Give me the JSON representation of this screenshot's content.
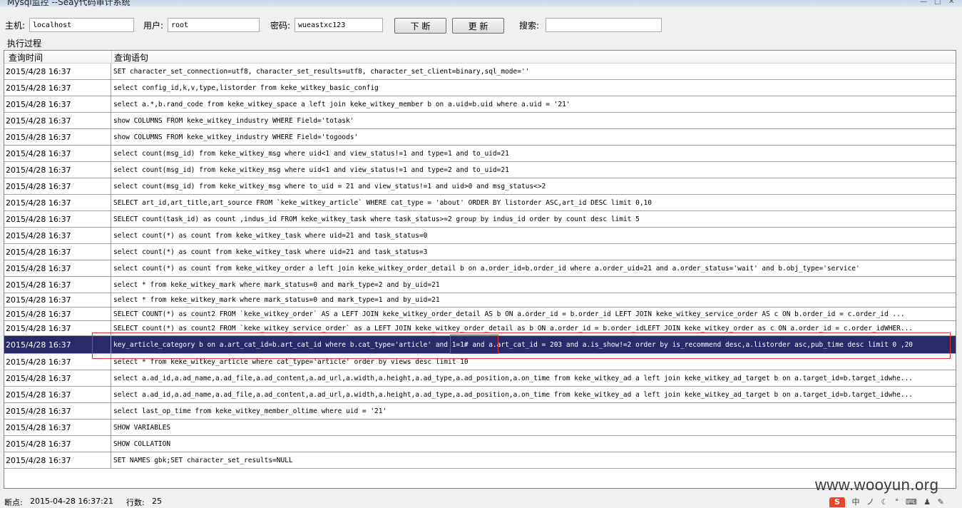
{
  "window": {
    "title": "Mysql监控 --Seay代码审计系统",
    "controls": [
      "—",
      "□",
      "✕"
    ]
  },
  "toolbar": {
    "host_label": "主机:",
    "host_value": "localhost",
    "user_label": "用户:",
    "user_value": "root",
    "password_label": "密码:",
    "password_value": "wueastxc123",
    "break_button": "下 断",
    "update_button": "更 新",
    "search_label": "搜索:",
    "search_value": ""
  },
  "section_label": "执行过程",
  "table": {
    "columns": [
      "查询时间",
      "查询语句"
    ],
    "rows": [
      {
        "time": "2015/4/28 16:37",
        "sql": "SET character_set_connection=utf8, character_set_results=utf8, character_set_client=binary,sql_mode=''"
      },
      {
        "time": "2015/4/28 16:37",
        "sql": "select config_id,k,v,type,listorder from keke_witkey_basic_config"
      },
      {
        "time": "2015/4/28 16:37",
        "sql": "select a.*,b.rand_code from keke_witkey_space a left join keke_witkey_member b on a.uid=b.uid where  a.uid = '21'"
      },
      {
        "time": "2015/4/28 16:37",
        "sql": "show COLUMNS FROM keke_witkey_industry WHERE Field='totask'"
      },
      {
        "time": "2015/4/28 16:37",
        "sql": "show COLUMNS FROM keke_witkey_industry WHERE Field='togoods'"
      },
      {
        "time": "2015/4/28 16:37",
        "sql": "select count(msg_id) from keke_witkey_msg where uid<1 and view_status!=1 and type=1 and  to_uid=21"
      },
      {
        "time": "2015/4/28 16:37",
        "sql": "select count(msg_id) from keke_witkey_msg where uid<1 and view_status!=1 and type=2 and  to_uid=21"
      },
      {
        "time": "2015/4/28 16:37",
        "sql": "select count(msg_id) from keke_witkey_msg where to_uid = 21 and view_status!=1 and uid>0 and msg_status<>2"
      },
      {
        "time": "2015/4/28 16:37",
        "sql": "SELECT art_id,art_title,art_source FROM `keke_witkey_article` WHERE cat_type = 'about' ORDER BY listorder ASC,art_id DESC limit 0,10"
      },
      {
        "time": "2015/4/28 16:37",
        "sql": "SELECT count(task_id) as count ,indus_id FROM  keke_witkey_task where task_status>=2 group by indus_id order by count desc limit 5"
      },
      {
        "time": "2015/4/28 16:37",
        "sql": "select count(*) as count from keke_witkey_task where uid=21 and task_status=0"
      },
      {
        "time": "2015/4/28 16:37",
        "sql": "select count(*) as count from keke_witkey_task where uid=21 and task_status=3"
      },
      {
        "time": "2015/4/28 16:37",
        "sql": "select count(*) as count from keke_witkey_order a left join keke_witkey_order_detail b on a.order_id=b.order_id where a.order_uid=21 and a.order_status='wait' and b.obj_type='service'"
      },
      {
        "time": "2015/4/28 16:37",
        "sql": "select * from keke_witkey_mark where mark_status=0 and mark_type=2 and by_uid=21"
      },
      {
        "time": "2015/4/28 16:37",
        "sql": "select * from keke_witkey_mark where mark_status=0 and mark_type=1 and by_uid=21"
      },
      {
        "time": "2015/4/28 16:37",
        "sql": "SELECT COUNT(*) as count2 FROM `keke_witkey_order` AS a  LEFT JOIN keke_witkey_order_detail AS b ON a.order_id = b.order_id  LEFT JOIN keke_witkey_service_order AS c ON b.order_id = c.order_id ..."
      },
      {
        "time": "2015/4/28 16:37",
        "sql": "SELECT count(*) as count2 FROM `keke_witkey_service_order` as a LEFT JOIN keke_witkey_order_detail as b ON a.order_id = b.order_idLEFT JOIN keke_witkey_order as c ON a.order_id = c.order_idWHER..."
      },
      {
        "time": "2015/4/28 16:37",
        "sql": "key_article_category b on a.art_cat_id=b.art_cat_id where b.cat_type='article'  and 1=1# and a.art_cat_id = 203 and a.is_show!=2 order by is_recommend desc,a.listorder asc,pub_time desc limit 0 ,20",
        "selected": true
      },
      {
        "time": "2015/4/28 16:37",
        "sql": "select * from keke_witkey_article where cat_type='article'  order by views desc limit 10"
      },
      {
        "time": "2015/4/28 16:37",
        "sql": "select a.ad_id,a.ad_name,a.ad_file,a.ad_content,a.ad_url,a.width,a.height,a.ad_type,a.ad_position,a.on_time from keke_witkey_ad a left join keke_witkey_ad_target b on a.target_id=b.target_idwhe..."
      },
      {
        "time": "2015/4/28 16:37",
        "sql": "select a.ad_id,a.ad_name,a.ad_file,a.ad_content,a.ad_url,a.width,a.height,a.ad_type,a.ad_position,a.on_time from keke_witkey_ad a left join keke_witkey_ad_target b on a.target_id=b.target_idwhe..."
      },
      {
        "time": "2015/4/28 16:37",
        "sql": "select last_op_time from keke_witkey_member_oltime where uid = '21'"
      },
      {
        "time": "2015/4/28 16:37",
        "sql": "SHOW VARIABLES"
      },
      {
        "time": "2015/4/28 16:37",
        "sql": "SHOW COLLATION"
      },
      {
        "time": "2015/4/28 16:37",
        "sql": "SET NAMES gbk;SET character_set_results=NULL"
      }
    ]
  },
  "status": {
    "breakpoint_label": "断点:",
    "breakpoint_value": "2015-04-28 16:37:21",
    "rows_label": "行数:",
    "rows_value": "25"
  },
  "watermark": "www.wooyun.org",
  "taskbar": {
    "ime_icon": "S",
    "ime_mode": "中"
  },
  "colors": {
    "selection": "#2a2a6b",
    "annotation": "#e03030",
    "ime": "#e8452c"
  }
}
